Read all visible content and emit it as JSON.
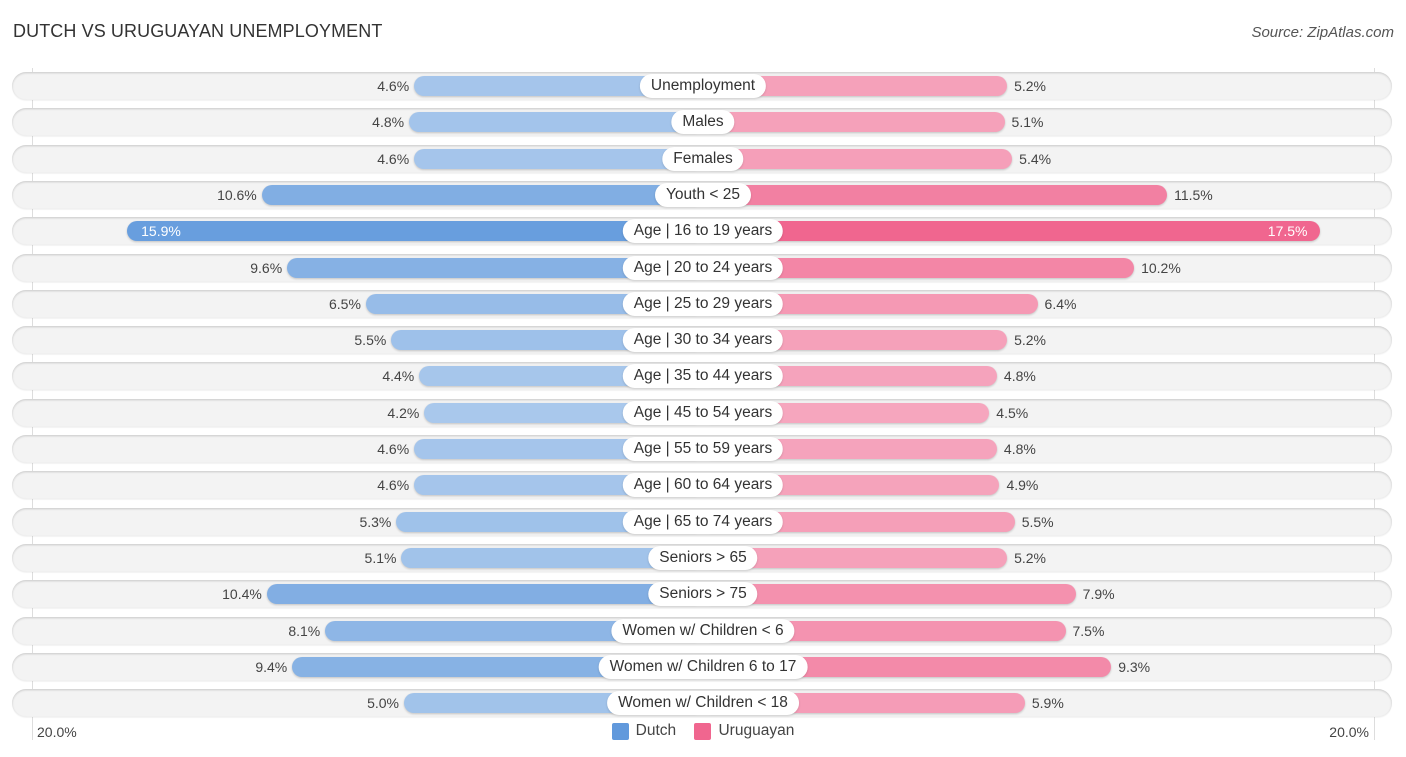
{
  "header": {
    "title": "DUTCH VS URUGUAYAN UNEMPLOYMENT",
    "source": "Source: ZipAtlas.com"
  },
  "chart_data": {
    "type": "bar",
    "orientation": "horizontal-diverging",
    "title": "DUTCH VS URUGUAYAN UNEMPLOYMENT",
    "xlabel": "",
    "ylabel": "",
    "xlim": [
      0,
      20.0
    ],
    "axis_ticks": {
      "left": "20.0%",
      "right": "20.0%"
    },
    "unit": "%",
    "legend_position": "bottom-center",
    "categories": [
      "Unemployment",
      "Males",
      "Females",
      "Youth < 25",
      "Age | 16 to 19 years",
      "Age | 20 to 24 years",
      "Age | 25 to 29 years",
      "Age | 30 to 34 years",
      "Age | 35 to 44 years",
      "Age | 45 to 54 years",
      "Age | 55 to 59 years",
      "Age | 60 to 64 years",
      "Age | 65 to 74 years",
      "Seniors > 65",
      "Seniors > 75",
      "Women w/ Children < 6",
      "Women w/ Children 6 to 17",
      "Women w/ Children < 18"
    ],
    "series": [
      {
        "name": "Dutch",
        "side": "left",
        "color": "#6199dc",
        "light_color": "#a9c8ec",
        "values": [
          4.6,
          4.8,
          4.6,
          10.6,
          15.9,
          9.6,
          6.5,
          5.5,
          4.4,
          4.2,
          4.6,
          4.6,
          5.3,
          5.1,
          10.4,
          8.1,
          9.4,
          5.0
        ],
        "labels": [
          "4.6%",
          "4.8%",
          "4.6%",
          "10.6%",
          "15.9%",
          "9.6%",
          "6.5%",
          "5.5%",
          "4.4%",
          "4.2%",
          "4.6%",
          "4.6%",
          "5.3%",
          "5.1%",
          "10.4%",
          "8.1%",
          "9.4%",
          "5.0%"
        ]
      },
      {
        "name": "Uruguayan",
        "side": "right",
        "color": "#f0668f",
        "light_color": "#f6a9c0",
        "values": [
          5.2,
          5.1,
          5.4,
          11.5,
          17.5,
          10.2,
          6.4,
          5.2,
          4.8,
          4.5,
          4.8,
          4.9,
          5.5,
          5.2,
          7.9,
          7.5,
          9.3,
          5.9
        ],
        "labels": [
          "5.2%",
          "5.1%",
          "5.4%",
          "11.5%",
          "17.5%",
          "10.2%",
          "6.4%",
          "5.2%",
          "4.8%",
          "4.5%",
          "4.8%",
          "4.9%",
          "5.5%",
          "5.2%",
          "7.9%",
          "7.5%",
          "9.3%",
          "5.9%"
        ]
      }
    ],
    "highlighted_row": "Age | 16 to 19 years"
  },
  "legend": {
    "items": [
      {
        "label": "Dutch",
        "color": "#6199dc"
      },
      {
        "label": "Uruguayan",
        "color": "#f0668f"
      }
    ]
  }
}
